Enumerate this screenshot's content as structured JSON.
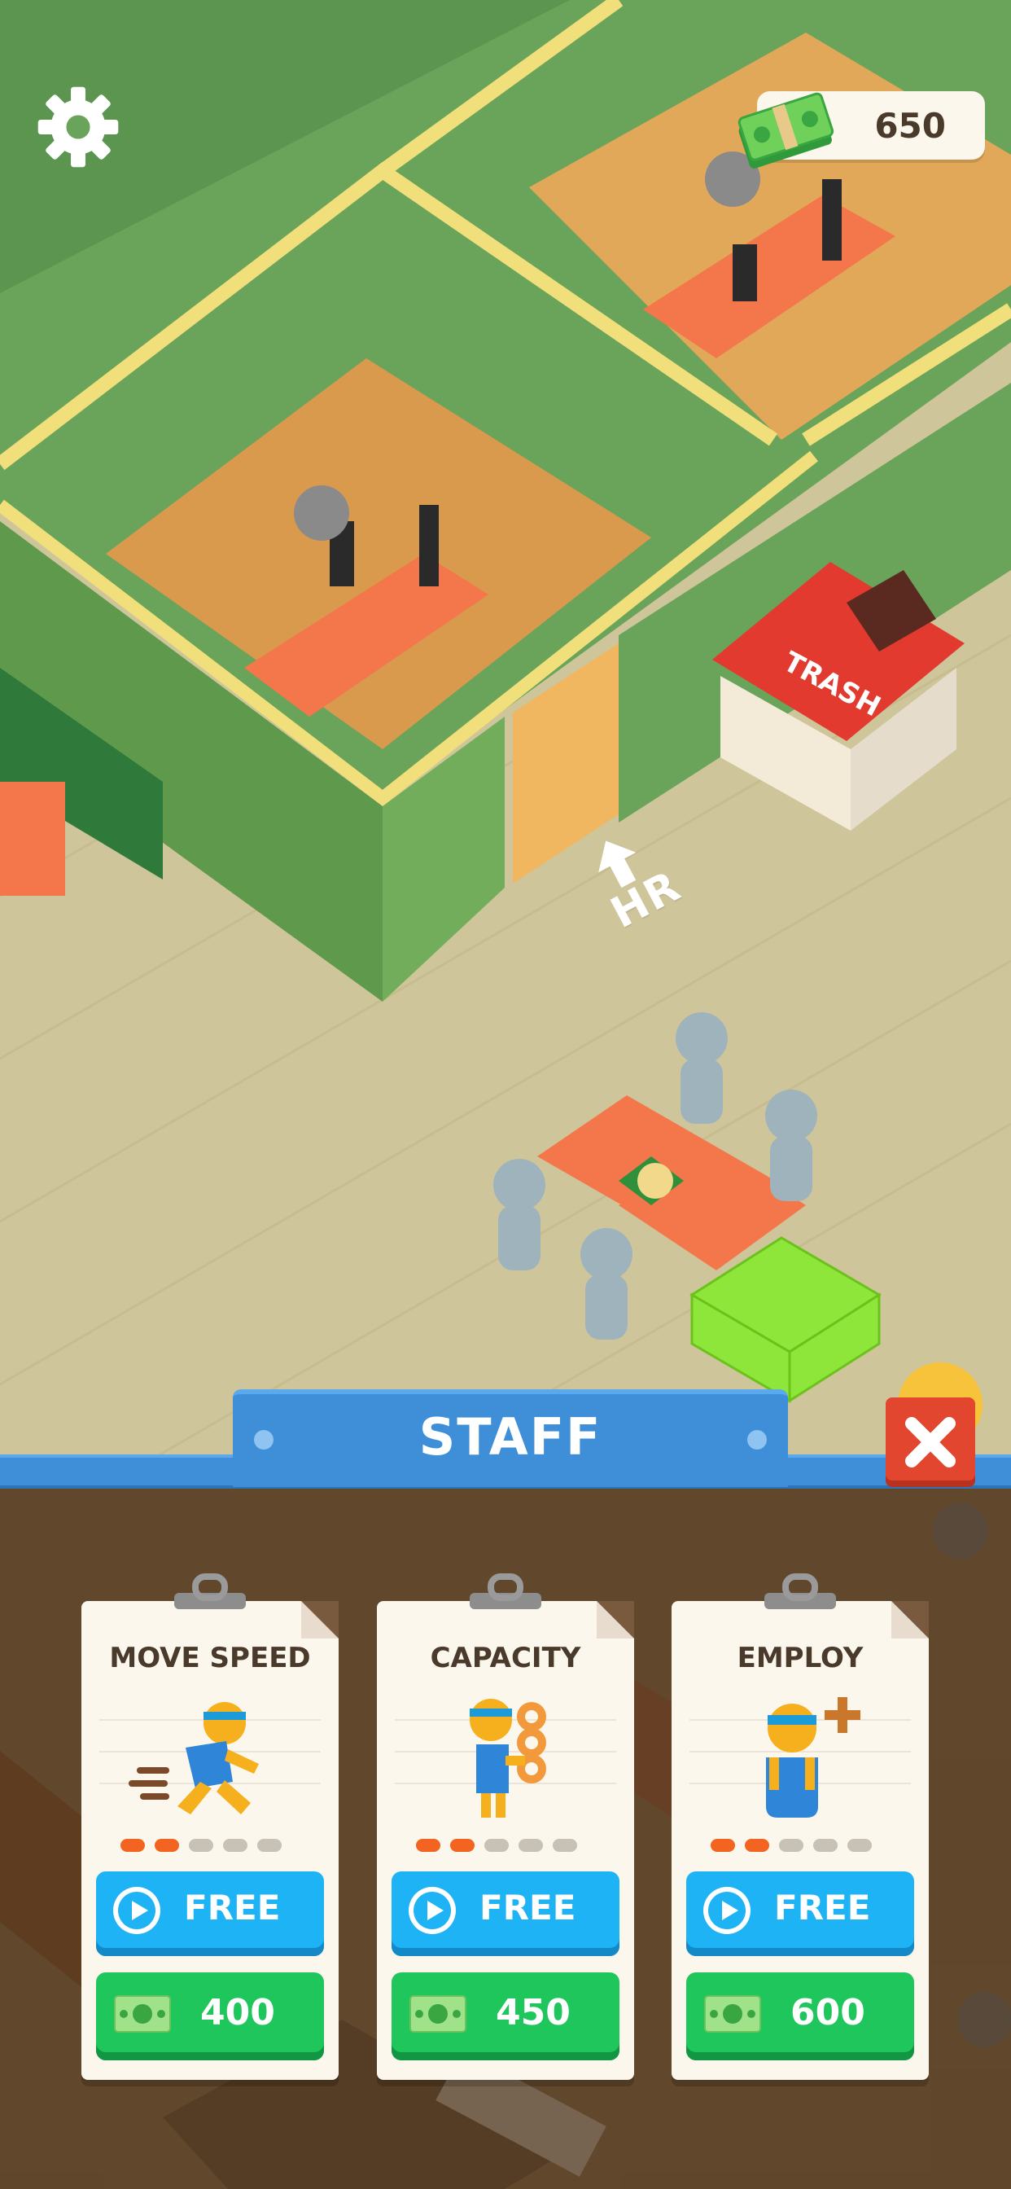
{
  "hud": {
    "money": "650",
    "settings_icon": "gear-icon",
    "money_icon": "cash-stack-icon"
  },
  "scene": {
    "trash_sign": "TRASH",
    "hr_arrow_label": "HR"
  },
  "panel": {
    "title": "STAFF",
    "close_icon": "close-icon",
    "cards": [
      {
        "title": "MOVE SPEED",
        "icon": "running-worker-icon",
        "level": 2,
        "max_level": 5,
        "free_label": "FREE",
        "price": "400"
      },
      {
        "title": "CAPACITY",
        "icon": "worker-carrying-donuts-icon",
        "level": 2,
        "max_level": 5,
        "free_label": "FREE",
        "price": "450"
      },
      {
        "title": "EMPLOY",
        "icon": "add-worker-icon",
        "level": 2,
        "max_level": 5,
        "free_label": "FREE",
        "price": "600"
      }
    ]
  },
  "colors": {
    "accent_blue": "#3f8fd8",
    "free_button": "#1db3f4",
    "cash_button": "#1ec65b",
    "close_red": "#e2462f",
    "level_on": "#f2641f"
  }
}
